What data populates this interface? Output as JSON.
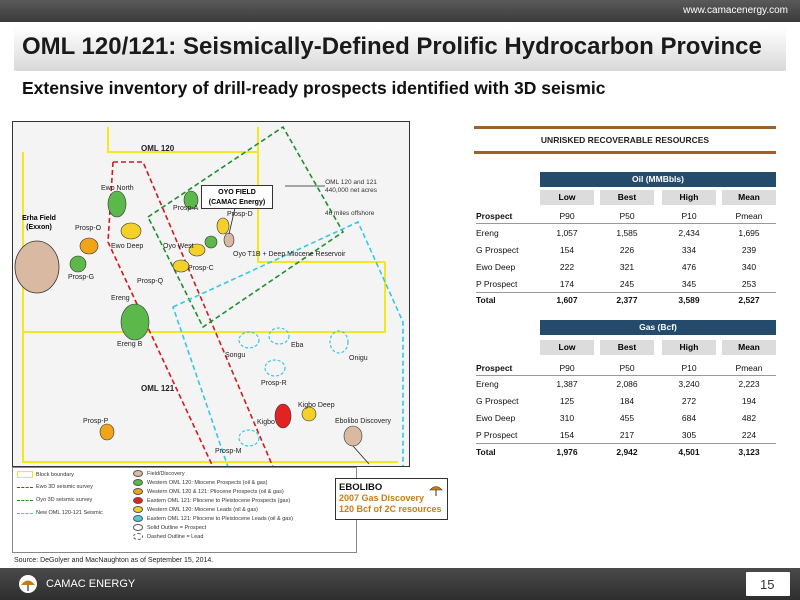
{
  "header": {
    "url": "www.camacenergy.com",
    "title": "OML 120/121: Seismically-Defined Prolific Hydrocarbon Province"
  },
  "subtitle": "Extensive inventory of drill-ready prospects identified with 3D seismic",
  "map": {
    "labels": {
      "oml120": "OML 120",
      "oml121": "OML 121",
      "oyo_field": "OYO FIELD",
      "oyo_operator": "(CAMAC Energy)",
      "erha_field": "Erha Field",
      "erha_operator": "(Exxon)",
      "net_acres_1": "OML 120 and 121",
      "net_acres_2": "440,000 net acres",
      "offshore": "46 miles offshore",
      "ewo_north": "Ewo North",
      "prosp_o": "Prosp-O",
      "ewo_deep": "Ewo Deep",
      "prosp_g": "Prosp-G",
      "prosp_q": "Prosp-Q",
      "prosp_a": "Prosp-A",
      "prosp_d": "Prosp-D",
      "oyo_west": "Oyo West",
      "prosp_c": "Prosp-C",
      "oyo_t1b": "Oyo T1B + Deep Miocene Reservoir",
      "ereng": "Ereng",
      "ereng_b": "Ereng B",
      "songu": "Songu",
      "eba": "Eba",
      "onigu": "Onigu",
      "prosp_r": "Prosp-R",
      "kigbo": "Kigbo",
      "kigbo_deep": "Kigbo Deep",
      "prosp_p": "Prosp-P",
      "prosp_m": "Prosp-M",
      "ebolibo_discovery": "Ebolibo Discovery"
    },
    "colors": {
      "oml_boundary": "#f2e81e",
      "ewo_3d": "#d11c1c",
      "oyo_3d": "#1f8f2e",
      "new_3d": "#37c8e0",
      "oil_green": "#5cb84a",
      "yellow": "#f3d12a",
      "orange": "#f0a419",
      "red": "#e42222",
      "cyan": "#4ecbe3",
      "discovery": "#d9b9a1"
    }
  },
  "legend": {
    "block_boundary": "Block boundary",
    "ewo_3d": "Ewo 3D seismic survey",
    "oyo_3d": "Oyo 3D seismic survey",
    "new_3d": "New OML 120-121 Seismic",
    "field_discovery": "Field/Discovery",
    "western_miocene": "Western OML 120: Miocene Prospects (oil & gas)",
    "western_pliocene": "Western OML 120 & 121: Pliocene Prospects (oil & gas)",
    "eastern_pliocene": "Eastern OML 121: Pliocene to Pleistocene Prospects (gas)",
    "western_leads": "Western OML 120: Miocene Leads (oil & gas)",
    "eastern_leads": "Eastern OML 121: Pliocene to Pleistocene Leads (oil & gas)",
    "solid": "Solid Outline = Prospect",
    "dashed": "Dashed Outline = Lead"
  },
  "ebolibo": {
    "title": "EBOLIBO",
    "line1": "2007 Gas Discovery",
    "line2": "120 Bcf of 2C resources"
  },
  "resources": {
    "title": "UNRISKED RECOVERABLE RESOURCES",
    "oil": {
      "band": "Oil (MMBbls)",
      "headers": [
        "Low",
        "Best",
        "High",
        "Mean"
      ],
      "subheaders": [
        "Prospect",
        "P90",
        "P50",
        "P10",
        "Pmean"
      ],
      "rows": [
        [
          "Ereng",
          "1,057",
          "1,585",
          "2,434",
          "1,695"
        ],
        [
          "G Prospect",
          "154",
          "226",
          "334",
          "239"
        ],
        [
          "Ewo Deep",
          "222",
          "321",
          "476",
          "340"
        ],
        [
          "P Prospect",
          "174",
          "245",
          "345",
          "253"
        ]
      ],
      "total": [
        "Total",
        "1,607",
        "2,377",
        "3,589",
        "2,527"
      ]
    },
    "gas": {
      "band": "Gas (Bcf)",
      "headers": [
        "Low",
        "Best",
        "High",
        "Mean"
      ],
      "subheaders": [
        "Prospect",
        "P90",
        "P50",
        "P10",
        "Pmean"
      ],
      "rows": [
        [
          "Ereng",
          "1,387",
          "2,086",
          "3,240",
          "2,223"
        ],
        [
          "G Prospect",
          "125",
          "184",
          "272",
          "194"
        ],
        [
          "Ewo Deep",
          "310",
          "455",
          "684",
          "482"
        ],
        [
          "P Prospect",
          "154",
          "217",
          "305",
          "224"
        ]
      ],
      "total": [
        "Total",
        "1,976",
        "2,942",
        "4,501",
        "3,123"
      ]
    }
  },
  "footer": {
    "source": "Source: DeGolyer and MacNaughton as of September 15, 2014.",
    "brand": "CAMAC ENERGY",
    "page": "15"
  }
}
